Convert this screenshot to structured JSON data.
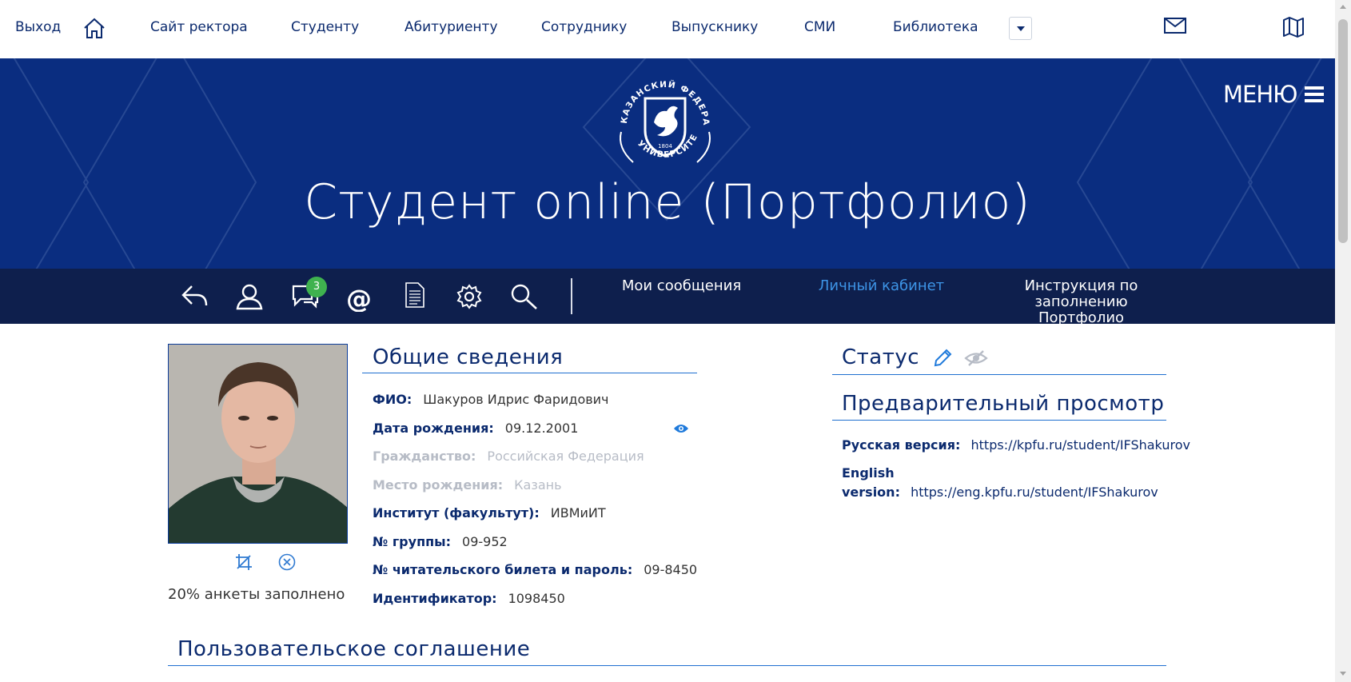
{
  "topnav": {
    "exit": "Выход",
    "items": [
      "Сайт ректора",
      "Студенту",
      "Абитуриенту",
      "Сотруднику",
      "Выпускнику",
      "СМИ",
      "Библиотека"
    ]
  },
  "banner": {
    "title": "Студент online (Портфолио)",
    "menu": "МЕНЮ",
    "logo_text": "КАЗАНСКИЙ ФЕДЕРАЛЬНЫЙ УНИВЕРСИТЕТ",
    "logo_year": "1804"
  },
  "toolbar": {
    "messages_badge": "3",
    "links": {
      "messages": "Мои сообщения",
      "cabinet": "Личный кабинет",
      "instruction": "Инструкция по заполнению Портфолио"
    }
  },
  "profile": {
    "fill_status": "20% анкеты заполнено"
  },
  "general": {
    "heading": "Общие сведения",
    "fields": [
      {
        "key": "ФИО:",
        "value": "Шакуров Идрис Фаридович"
      },
      {
        "key": "Дата рождения:",
        "value": "09.12.2001"
      },
      {
        "key": "Гражданство:",
        "value": "Российская Федерация"
      },
      {
        "key": "Место рождения:",
        "value": "Казань"
      },
      {
        "key": "Институт (факультут):",
        "value": "ИВМиИТ"
      },
      {
        "key": "№ группы:",
        "value": "09-952"
      },
      {
        "key": "№ читательского билета и пароль:",
        "value": "09-8450"
      },
      {
        "key": "Идентификатор:",
        "value": "1098450"
      }
    ]
  },
  "status": {
    "heading": "Статус"
  },
  "preview": {
    "heading": "Предварительный просмотр",
    "ru_label": "Русская версия:",
    "ru_url": "https://kpfu.ru/student/IFShakurov",
    "en_label_1": "English",
    "en_label_2": "version:",
    "en_url": "https://eng.kpfu.ru/student/IFShakurov"
  },
  "agreement": {
    "heading": "Пользовательское соглашение"
  },
  "colors": {
    "banner": "#0a2d80",
    "toolbar": "#0e1f4d",
    "accent": "#3d94e6",
    "badge": "#3fb24f"
  }
}
